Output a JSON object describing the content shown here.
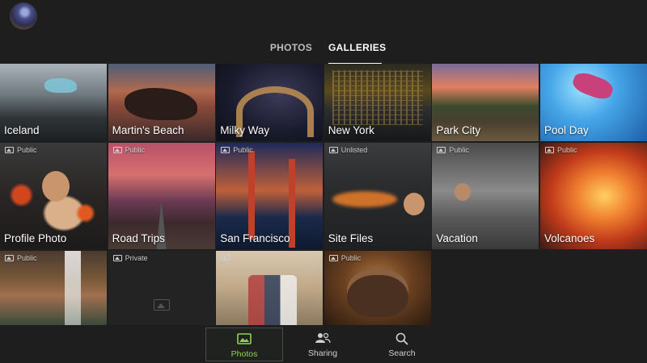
{
  "header": {
    "avatar_icon": "profile-avatar",
    "tabs": [
      {
        "label": "PHOTOS",
        "active": false
      },
      {
        "label": "GALLERIES",
        "active": true
      }
    ]
  },
  "galleries": [
    {
      "name": "Iceland",
      "visibility": ""
    },
    {
      "name": "Martin's Beach",
      "visibility": ""
    },
    {
      "name": "Milky Way",
      "visibility": ""
    },
    {
      "name": "New York",
      "visibility": ""
    },
    {
      "name": "Park City",
      "visibility": ""
    },
    {
      "name": "Pool Day",
      "visibility": ""
    },
    {
      "name": "Profile Photo",
      "visibility": "Public"
    },
    {
      "name": "Road Trips",
      "visibility": "Public"
    },
    {
      "name": "San Francisco",
      "visibility": "Public"
    },
    {
      "name": "Site Files",
      "visibility": "Unlisted"
    },
    {
      "name": "Vacation",
      "visibility": "Public"
    },
    {
      "name": "Volcanoes",
      "visibility": "Public"
    },
    {
      "name": "",
      "visibility": "Public"
    },
    {
      "name": "",
      "visibility": "Private"
    },
    {
      "name": "",
      "visibility": ""
    },
    {
      "name": "",
      "visibility": "Public"
    }
  ],
  "bottom_nav": {
    "items": [
      {
        "label": "Photos",
        "icon": "photos-icon",
        "active": true,
        "color": "#8fd14f"
      },
      {
        "label": "Sharing",
        "icon": "sharing-icon",
        "active": false
      },
      {
        "label": "Search",
        "icon": "search-icon",
        "active": false
      }
    ]
  }
}
